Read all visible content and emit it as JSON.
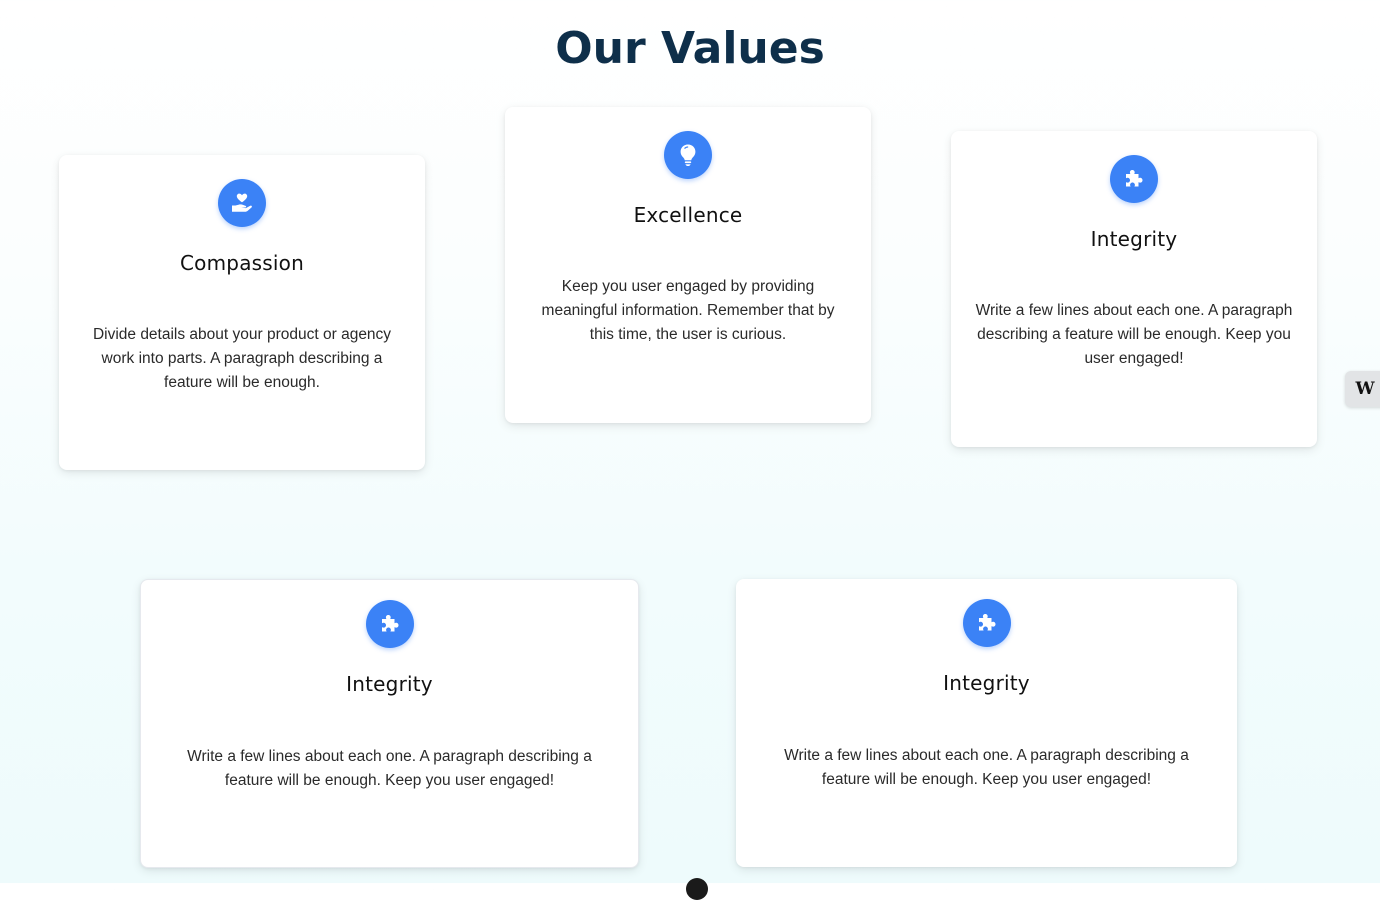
{
  "page": {
    "title": "Our Values"
  },
  "cards": [
    {
      "icon": "hand-heart-icon",
      "title": "Compassion",
      "text": "Divide details about your product or agency work into parts. A paragraph describing a feature will be enough."
    },
    {
      "icon": "lightbulb-icon",
      "title": "Excellence",
      "text": "Keep you user engaged by providing meaningful information. Remember that by this time, the user is curious."
    },
    {
      "icon": "puzzle-icon",
      "title": "Integrity",
      "text": "Write a few lines about each one. A paragraph describing a feature will be enough. Keep you user engaged!"
    },
    {
      "icon": "puzzle-icon",
      "title": "Integrity",
      "text": "Write a few lines about each one. A paragraph describing a feature will be enough. Keep you user engaged!"
    },
    {
      "icon": "puzzle-icon",
      "title": "Integrity",
      "text": "Write a few lines about each one. A paragraph describing a feature will be enough. Keep you user engaged!"
    }
  ],
  "widget": {
    "label": "W"
  },
  "colors": {
    "accent": "#3b82f6",
    "heading": "#0e2f4a"
  }
}
